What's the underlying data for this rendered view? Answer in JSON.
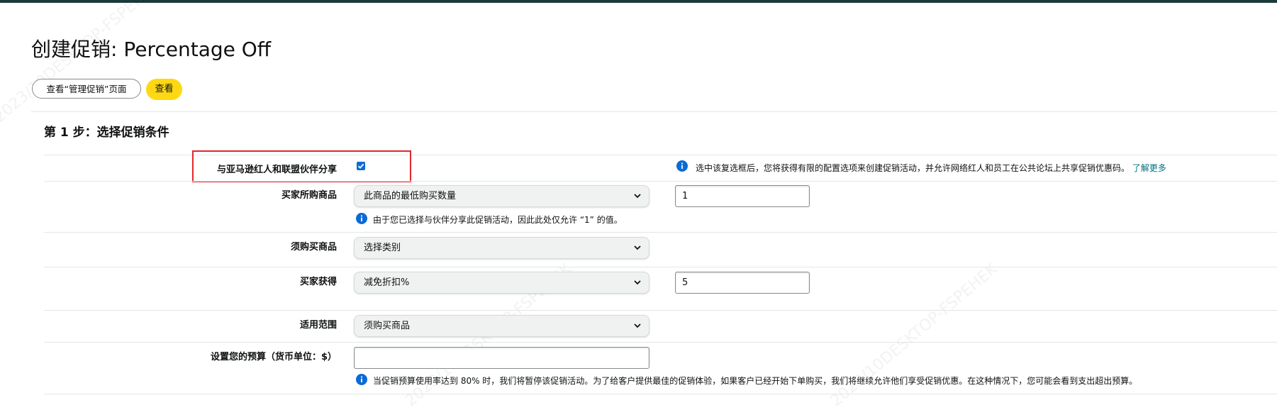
{
  "page": {
    "title": "创建促销: Percentage Off",
    "manage_button": "查看“管理促销”页面",
    "view_button": "查看"
  },
  "step": {
    "title": "第 1 步：选择促销条件"
  },
  "share": {
    "label": "与亚马逊红人和联盟伙伴分享",
    "checked": true,
    "info": "选中该复选框后，您将获得有限的配置选项来创建促销活动，并允许网络红人和员工在公共论坛上共享促销优惠码。",
    "learn_more": "了解更多"
  },
  "buyer_purchases": {
    "label": "买家所购商品",
    "select_value": "此商品的最低购买数量",
    "input_value": "1",
    "note": "由于您已选择与伙伴分享此促销活动，因此此处仅允许 “1” 的值。"
  },
  "purchased_items": {
    "label": "须购买商品",
    "select_value": "选择类别"
  },
  "buyer_gets": {
    "label": "买家获得",
    "select_value": "减免折扣%",
    "input_value": "5"
  },
  "applies_to": {
    "label": "适用范围",
    "select_value": "须购买商品"
  },
  "budget": {
    "label": "设置您的预算（货币单位：$）",
    "input_value": "",
    "note": "当促销预算使用率达到 80% 时，我们将暂停该促销活动。为了给客户提供最佳的促销体验，如果客户已经开始下单购买，我们将继续允许他们享受促销优惠。在这种情况下，您可能会看到支出超出预算。"
  },
  "watermark": "2023/10DESKTOP-FSPEHEK",
  "colors": {
    "primary_button": "#ffd814",
    "highlight": "#e0272c",
    "info": "#0b6bd6",
    "link": "#007185"
  }
}
